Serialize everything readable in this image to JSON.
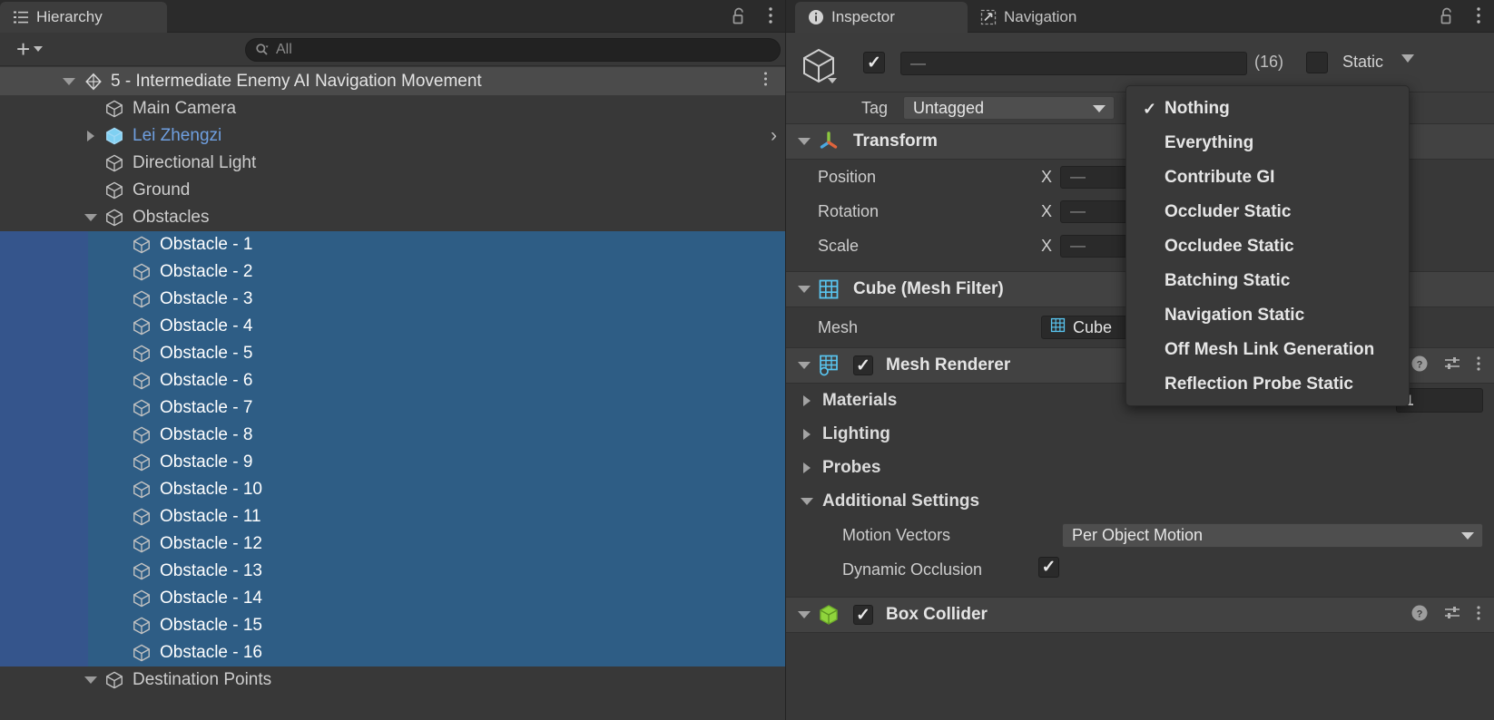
{
  "hierarchy": {
    "tab_label": "Hierarchy",
    "tab_icon": "hierarchy-list-icon",
    "lock_icon": "lock-open-icon",
    "menu_icon": "kebab-menu-icon",
    "add_button_label": "+",
    "search": {
      "placeholder": "All",
      "value": "All",
      "icon": "search-icon"
    },
    "scene": {
      "name": "5 - Intermediate Enemy AI Navigation Movement",
      "icon": "unity-scene-icon",
      "expanded": true
    },
    "items": [
      {
        "label": "Main Camera",
        "depth": 1,
        "icon": "cube-icon",
        "expanded": null,
        "selected": false,
        "highlight": false
      },
      {
        "label": "Lei Zhengzi",
        "depth": 1,
        "icon": "prefab-cube-icon",
        "expanded": false,
        "selected": false,
        "highlight": true
      },
      {
        "label": "Directional Light",
        "depth": 1,
        "icon": "cube-icon",
        "expanded": null,
        "selected": false,
        "highlight": false
      },
      {
        "label": "Ground",
        "depth": 1,
        "icon": "cube-icon",
        "expanded": null,
        "selected": false,
        "highlight": false
      },
      {
        "label": "Obstacles",
        "depth": 1,
        "icon": "cube-icon",
        "expanded": true,
        "selected": false,
        "highlight": false
      },
      {
        "label": "Obstacle - 1",
        "depth": 2,
        "icon": "cube-icon",
        "expanded": null,
        "selected": true,
        "highlight": false
      },
      {
        "label": "Obstacle - 2",
        "depth": 2,
        "icon": "cube-icon",
        "expanded": null,
        "selected": true,
        "highlight": false
      },
      {
        "label": "Obstacle - 3",
        "depth": 2,
        "icon": "cube-icon",
        "expanded": null,
        "selected": true,
        "highlight": false
      },
      {
        "label": "Obstacle - 4",
        "depth": 2,
        "icon": "cube-icon",
        "expanded": null,
        "selected": true,
        "highlight": false
      },
      {
        "label": "Obstacle - 5",
        "depth": 2,
        "icon": "cube-icon",
        "expanded": null,
        "selected": true,
        "highlight": false
      },
      {
        "label": "Obstacle - 6",
        "depth": 2,
        "icon": "cube-icon",
        "expanded": null,
        "selected": true,
        "highlight": false
      },
      {
        "label": "Obstacle - 7",
        "depth": 2,
        "icon": "cube-icon",
        "expanded": null,
        "selected": true,
        "highlight": false
      },
      {
        "label": "Obstacle - 8",
        "depth": 2,
        "icon": "cube-icon",
        "expanded": null,
        "selected": true,
        "highlight": false
      },
      {
        "label": "Obstacle - 9",
        "depth": 2,
        "icon": "cube-icon",
        "expanded": null,
        "selected": true,
        "highlight": false
      },
      {
        "label": "Obstacle - 10",
        "depth": 2,
        "icon": "cube-icon",
        "expanded": null,
        "selected": true,
        "highlight": false
      },
      {
        "label": "Obstacle - 11",
        "depth": 2,
        "icon": "cube-icon",
        "expanded": null,
        "selected": true,
        "highlight": false
      },
      {
        "label": "Obstacle - 12",
        "depth": 2,
        "icon": "cube-icon",
        "expanded": null,
        "selected": true,
        "highlight": false
      },
      {
        "label": "Obstacle - 13",
        "depth": 2,
        "icon": "cube-icon",
        "expanded": null,
        "selected": true,
        "highlight": false
      },
      {
        "label": "Obstacle - 14",
        "depth": 2,
        "icon": "cube-icon",
        "expanded": null,
        "selected": true,
        "highlight": false
      },
      {
        "label": "Obstacle - 15",
        "depth": 2,
        "icon": "cube-icon",
        "expanded": null,
        "selected": true,
        "highlight": false
      },
      {
        "label": "Obstacle - 16",
        "depth": 2,
        "icon": "cube-icon",
        "expanded": null,
        "selected": true,
        "highlight": false
      },
      {
        "label": "Destination Points",
        "depth": 1,
        "icon": "cube-icon",
        "expanded": true,
        "selected": false,
        "highlight": false
      }
    ]
  },
  "inspector": {
    "tabs": [
      {
        "label": "Inspector",
        "icon": "info-circle-icon",
        "active": true
      },
      {
        "label": "Navigation",
        "icon": "navigation-icon",
        "active": false
      }
    ],
    "lock_icon": "lock-open-icon",
    "menu_icon": "kebab-menu-icon",
    "object_header": {
      "icon": "cube-icon",
      "enabled": true,
      "name_value": "—",
      "multi_count": "(16)",
      "static_label": "Static",
      "static_checked": false,
      "static_dropdown_icon": "chevron-down-icon"
    },
    "tag_row": {
      "label": "Tag",
      "value": "Untagged"
    },
    "components": {
      "transform": {
        "title": "Transform",
        "icon": "transform-axis-icon",
        "expanded": true,
        "rows": [
          {
            "label": "Position",
            "axis": "X",
            "value": "—"
          },
          {
            "label": "Rotation",
            "axis": "X",
            "value": "—"
          },
          {
            "label": "Scale",
            "axis": "X",
            "value": "—"
          }
        ]
      },
      "mesh_filter": {
        "title": "Cube (Mesh Filter)",
        "icon": "mesh-filter-icon",
        "expanded": true,
        "mesh_label": "Mesh",
        "mesh_value": "Cube",
        "mesh_value_icon": "mesh-icon"
      },
      "mesh_renderer": {
        "title": "Mesh Renderer",
        "icon": "mesh-renderer-icon",
        "enabled": true,
        "expanded": true,
        "help_icon": "help-circle-icon",
        "preset_icon": "preset-sliders-icon",
        "menu_icon": "kebab-menu-icon",
        "foldouts": [
          {
            "label": "Materials",
            "expanded": false,
            "count": "1"
          },
          {
            "label": "Lighting",
            "expanded": false,
            "count": null
          },
          {
            "label": "Probes",
            "expanded": false,
            "count": null
          }
        ],
        "additional_settings": {
          "label": "Additional Settings",
          "expanded": true,
          "motion_vectors_label": "Motion Vectors",
          "motion_vectors_value": "Per Object Motion",
          "dynamic_occlusion_label": "Dynamic Occlusion",
          "dynamic_occlusion_checked": true
        }
      },
      "box_collider": {
        "title": "Box Collider",
        "icon": "box-collider-icon",
        "enabled": true,
        "expanded": true,
        "help_icon": "help-circle-icon",
        "preset_icon": "preset-sliders-icon",
        "menu_icon": "kebab-menu-icon"
      }
    }
  },
  "static_menu": {
    "items": [
      {
        "label": "Nothing",
        "checked": true
      },
      {
        "label": "Everything",
        "checked": false
      },
      {
        "label": "Contribute GI",
        "checked": false
      },
      {
        "label": "Occluder Static",
        "checked": false
      },
      {
        "label": "Occludee Static",
        "checked": false
      },
      {
        "label": "Batching Static",
        "checked": false
      },
      {
        "label": "Navigation Static",
        "checked": false
      },
      {
        "label": "Off Mesh Link Generation",
        "checked": false
      },
      {
        "label": "Reflection Probe Static",
        "checked": false
      }
    ],
    "check_glyph": "✓"
  },
  "colors": {
    "panel_bg": "#383838",
    "tab_bg": "#2b2b2b",
    "selection_blue": "#2e5d85",
    "selection_indent_blue": "#35558c",
    "prefab_blue": "#5a9ddd",
    "accent_cyan": "#59c5f0",
    "collider_green": "#8fd43c"
  }
}
